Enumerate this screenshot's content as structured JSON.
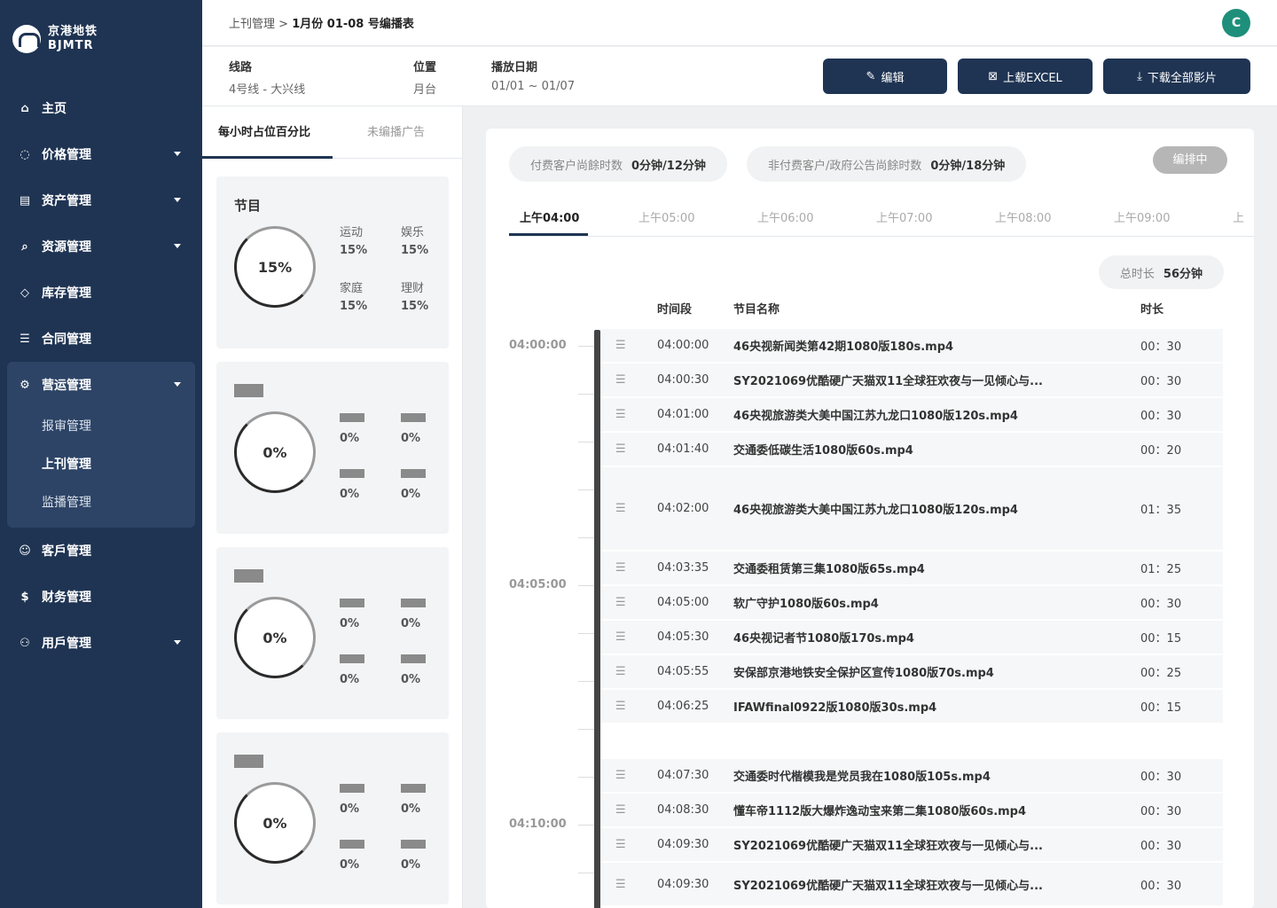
{
  "brand": {
    "name_cn": "京港地铁",
    "name_en": "BJMTR"
  },
  "sidebar": {
    "items": [
      {
        "label": "主页",
        "icon": "home-icon"
      },
      {
        "label": "价格管理",
        "icon": "price-tag-icon"
      },
      {
        "label": "资产管理",
        "icon": "train-icon"
      },
      {
        "label": "资源管理",
        "icon": "resource-search-icon"
      },
      {
        "label": "库存管理",
        "icon": "box-icon"
      },
      {
        "label": "合同管理",
        "icon": "contract-icon"
      },
      {
        "label": "营运管理",
        "icon": "gear-icon"
      },
      {
        "label": "客戶管理",
        "icon": "user-icon"
      },
      {
        "label": "财务管理",
        "icon": "dollar-icon"
      },
      {
        "label": "用戶管理",
        "icon": "users-icon"
      }
    ],
    "sub_items": [
      {
        "label": "报审管理"
      },
      {
        "label": "上刊管理"
      },
      {
        "label": "监播管理"
      }
    ]
  },
  "header": {
    "breadcrumb_parent": "上刊管理",
    "breadcrumb_sep": ">",
    "breadcrumb_current": "1月份 01-08 号编播表",
    "avatar_letter": "C"
  },
  "info": {
    "line_label": "线路",
    "line_value": "4号线 - 大兴线",
    "position_label": "位置",
    "position_value": "月台",
    "date_label": "播放日期",
    "date_value": "01/01 ~ 01/07"
  },
  "buttons": {
    "edit": "编辑",
    "upload_excel": "上载EXCEL",
    "download_all": "下载全部影片"
  },
  "left_tabs": {
    "active": "每小时占位百分比",
    "inactive": "未编播广告"
  },
  "cards": [
    {
      "title": "节目",
      "percent": "15%",
      "stats": [
        {
          "k": "运动",
          "v": "15%"
        },
        {
          "k": "娱乐",
          "v": "15%"
        },
        {
          "k": "家庭",
          "v": "15%"
        },
        {
          "k": "理财",
          "v": "15%"
        }
      ]
    },
    {
      "title": "",
      "percent": "0%",
      "stats": [
        {
          "k": "",
          "v": "0%"
        },
        {
          "k": "",
          "v": "0%"
        },
        {
          "k": "",
          "v": "0%"
        },
        {
          "k": "",
          "v": "0%"
        }
      ]
    },
    {
      "title": "",
      "percent": "0%",
      "stats": [
        {
          "k": "",
          "v": "0%"
        },
        {
          "k": "",
          "v": "0%"
        },
        {
          "k": "",
          "v": "0%"
        },
        {
          "k": "",
          "v": "0%"
        }
      ]
    },
    {
      "title": "",
      "percent": "0%",
      "stats": [
        {
          "k": "",
          "v": "0%"
        },
        {
          "k": "",
          "v": "0%"
        },
        {
          "k": "",
          "v": "0%"
        },
        {
          "k": "",
          "v": "0%"
        }
      ]
    }
  ],
  "summary": {
    "paid_label": "付费客户尚餘时数",
    "paid_value": "0分钟/12分钟",
    "free_label": "非付费客户/政府公告尚餘时数",
    "free_value": "0分钟/18分钟",
    "status": "编排中"
  },
  "time_tabs": [
    "上午04:00",
    "上午05:00",
    "上午06:00",
    "上午07:00",
    "上午08:00",
    "上午09:00",
    "上"
  ],
  "total": {
    "label": "总时长",
    "value": "56分钟"
  },
  "columns": {
    "time": "时间段",
    "name": "节目名称",
    "duration": "时长"
  },
  "timeline_labels": [
    "04:00:00",
    "04:05:00",
    "04:10:00"
  ],
  "rows": [
    {
      "time": "04:00:00",
      "name": "46央视新闻类第42期1080版180s.mp4",
      "duration": "00：30"
    },
    {
      "time": "04:00:30",
      "name": "SY2021069优酷硬广天猫双11全球狂欢夜与一见倾心与...",
      "duration": "00：30"
    },
    {
      "time": "04:01:00",
      "name": "46央视旅游类大美中国江苏九龙口1080版120s.mp4",
      "duration": "00：30"
    },
    {
      "time": "04:01:40",
      "name": "交通委低碳生活1080版60s.mp4",
      "duration": "00：20"
    },
    {
      "time": "04:02:00",
      "name": "46央视旅游类大美中国江苏九龙口1080版120s.mp4",
      "duration": "01：35"
    },
    {
      "time": "04:03:35",
      "name": "交通委租赁第三集1080版65s.mp4",
      "duration": "01：25"
    },
    {
      "time": "04:05:00",
      "name": "软广守护1080版60s.mp4",
      "duration": "00：30"
    },
    {
      "time": "04:05:30",
      "name": "46央视记者节1080版170s.mp4",
      "duration": "00：15"
    },
    {
      "time": "04:05:55",
      "name": "安保部京港地铁安全保护区宣传1080版70s.mp4",
      "duration": "00：25"
    },
    {
      "time": "04:06:25",
      "name": "IFAWfinal0922版1080版30s.mp4",
      "duration": "00：15"
    },
    {
      "time": "04:07:30",
      "name": "交通委时代楷模我是党员我在1080版105s.mp4",
      "duration": "00：30"
    },
    {
      "time": "04:08:30",
      "name": "懂车帝1112版大爆炸逸动宝来第二集1080版60s.mp4",
      "duration": "00：30"
    },
    {
      "time": "04:09:30",
      "name": "SY2021069优酷硬广天猫双11全球狂欢夜与一见倾心与...",
      "duration": "00：30"
    },
    {
      "time": "04:09:30",
      "name": "SY2021069优酷硬广天猫双11全球狂欢夜与一见倾心与...",
      "duration": "00：30"
    }
  ]
}
